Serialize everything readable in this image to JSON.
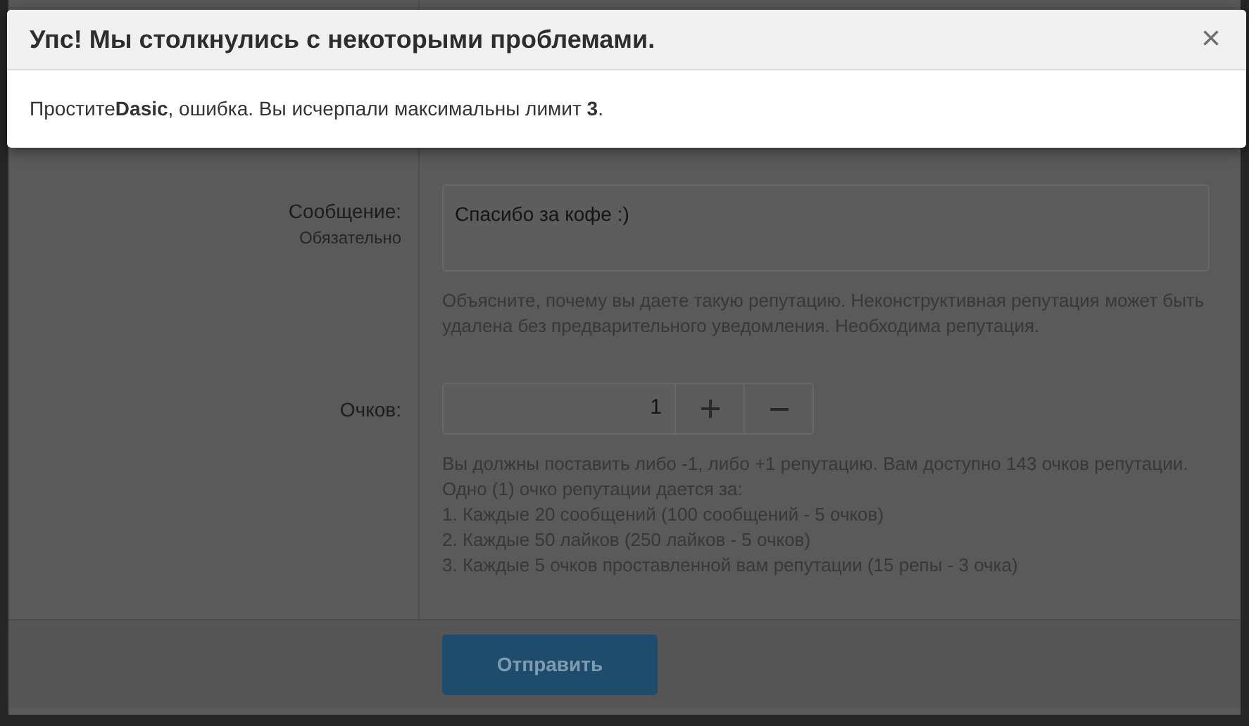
{
  "dialog": {
    "title": "Упс! Мы столкнулись с некоторыми проблемами.",
    "close": "×",
    "message": "Простите**Dasic**, ошибка. Вы исчерпали максимальны лимит **3**."
  },
  "form": {
    "fields": [
      {
        "kind": "textarea",
        "label": "Сообщение:",
        "sublabel": "Обязательно",
        "value": "Спасибо за кофе :)",
        "hint": [
          "Объясните, почему вы даете такую репутацию. Неконструктивная репутация может быть удалена без предварительного уведомления. Необходима репутация."
        ]
      },
      {
        "kind": "stepper",
        "label": "Очков:",
        "value": "1",
        "hint": [
          "Вы должны поставить либо -1, либо +1 репутацию. Вам доступно 143 очков репутации.",
          "Одно (1) очко репутации дается за:",
          "1. Каждые 20 сообщений (100 сообщений - 5 очков)",
          "2. Каждые 50 лайков (250 лайков - 5 очков)",
          "3. Каждые 5 очков проставленной вам репутации (15 репы - 3 очка)"
        ]
      }
    ],
    "submit": "Отправить"
  }
}
